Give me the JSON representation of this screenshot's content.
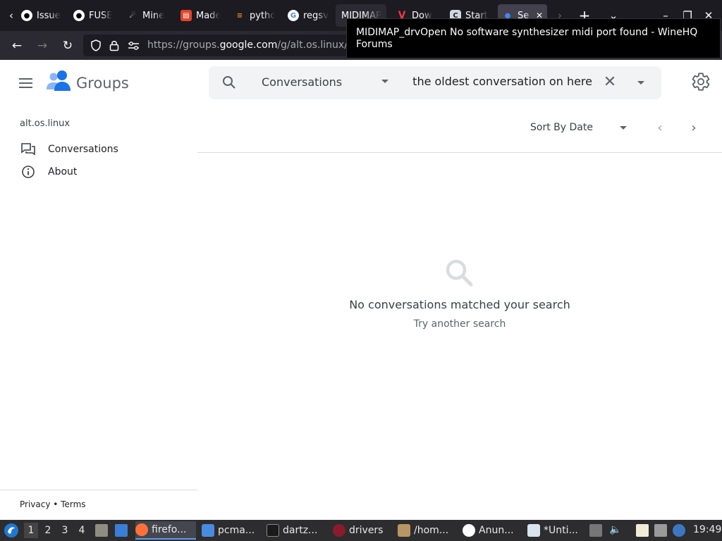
{
  "browser": {
    "tabs": [
      {
        "title": "Issue",
        "icon": "github-icon"
      },
      {
        "title": "FUSE",
        "icon": "github-icon"
      },
      {
        "title": "Mine",
        "icon": "mine-icon"
      },
      {
        "title": "Made",
        "icon": "made-icon"
      },
      {
        "title": "python",
        "icon": "stackoverflow-icon"
      },
      {
        "title": "regsvr",
        "icon": "google-icon"
      },
      {
        "title": "MIDIMAP",
        "icon": ""
      },
      {
        "title": "Dow",
        "icon": "vivaldi-icon"
      },
      {
        "title": "Start",
        "icon": "start-icon"
      },
      {
        "title": "Se",
        "icon": "groups-icon"
      }
    ],
    "url_dim_prefix": "https://groups.",
    "url_main": "google.com",
    "url_suffix": "/g/alt.os.linux/",
    "tooltip": "MIDIMAP_drvOpen No software synthesizer midi port found - WineHQ Forums"
  },
  "app": {
    "brand": "Groups",
    "search_scope": "Conversations",
    "search_query": "whats the oldest conversation on here",
    "group_name": "alt.os.linux",
    "nav": [
      {
        "label": "Conversations"
      },
      {
        "label": "About"
      }
    ],
    "sort_label": "Sort By Date",
    "empty_title": "No conversations matched your search",
    "empty_subtitle": "Try another search",
    "footer_privacy": "Privacy",
    "footer_sep": " • ",
    "footer_terms": "Terms",
    "colors": {
      "google_blue": "#1a73e8",
      "text": "#202124",
      "muted": "#5f6368"
    }
  },
  "taskbar": {
    "workspaces": [
      "1",
      "2",
      "3",
      "4"
    ],
    "tasks": [
      {
        "label": "firefo..."
      },
      {
        "label": "pcma..."
      },
      {
        "label": "dartz..."
      },
      {
        "label": "drivers"
      },
      {
        "label": "/hom..."
      },
      {
        "label": "Anun..."
      },
      {
        "label": "*Unti..."
      }
    ],
    "clock": "19:49"
  }
}
